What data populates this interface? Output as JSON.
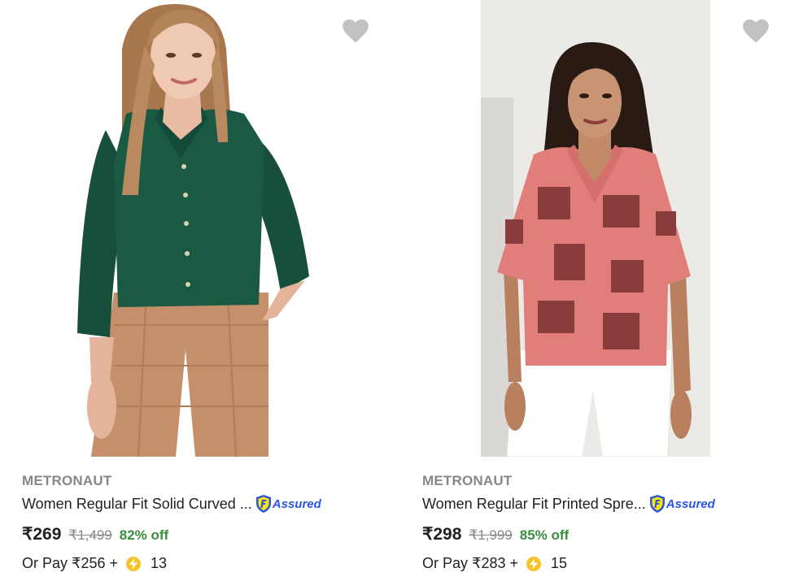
{
  "products": [
    {
      "brand": "METRONAUT",
      "title": "Women Regular Fit Solid Curved ...",
      "assured": "Assured",
      "price": "₹269",
      "mrp": "₹1,499",
      "discount": "82% off",
      "pay_prefix": "Or Pay ₹256 +",
      "coins": "13",
      "image_alt": "Woman wearing dark green shirt with beige checked trousers"
    },
    {
      "brand": "METRONAUT",
      "title": "Women Regular Fit Printed Spre...",
      "assured": "Assured",
      "price": "₹298",
      "mrp": "₹1,999",
      "discount": "85% off",
      "pay_prefix": "Or Pay ₹283 +",
      "coins": "15",
      "image_alt": "Woman wearing pink printed short sleeve shirt with white trousers"
    }
  ],
  "colors": {
    "brand_grey": "#878787",
    "discount_green": "#388e3c",
    "assured_blue": "#2a55e5",
    "coin_yellow": "#f7c325",
    "wishlist_grey": "#c2c2c2"
  },
  "icons": {
    "wishlist": "heart-icon",
    "assured": "assured-shield-icon",
    "coin": "supercoin-icon"
  }
}
